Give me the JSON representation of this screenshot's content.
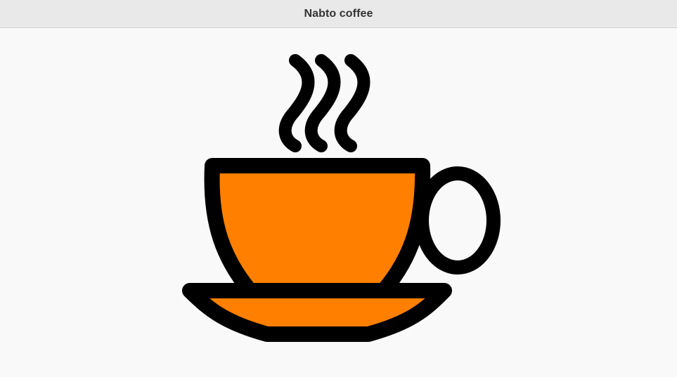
{
  "header": {
    "title": "Nabto coffee"
  },
  "main": {
    "image": {
      "icon": "coffee-cup-icon",
      "fill_color": "#ff8000",
      "outline_color": "#000000"
    }
  }
}
